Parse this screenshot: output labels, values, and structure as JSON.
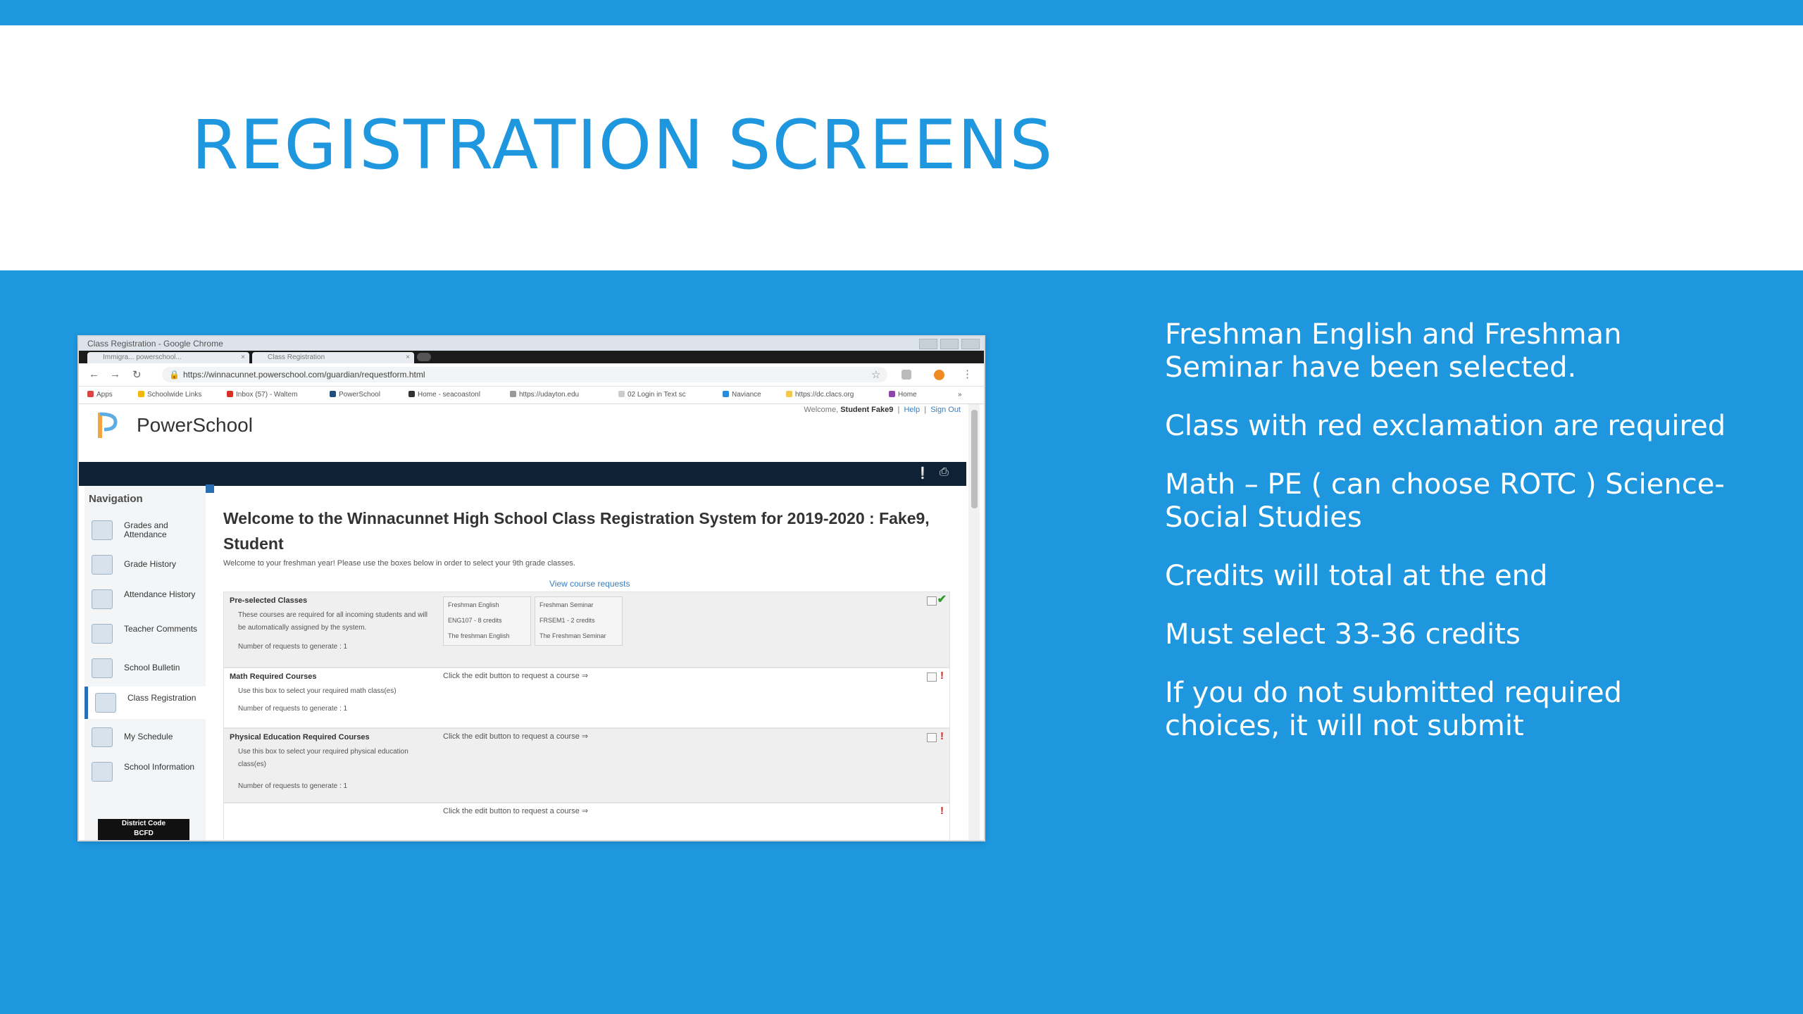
{
  "slide": {
    "title": "REGISTRATION SCREENS",
    "bullets": [
      "Freshman English and Freshman Seminar have been selected.",
      "Class with red exclamation are required",
      "Math – PE ( can choose ROTC ) Science-Social Studies",
      "Credits will total at the end",
      "Must select 33-36 credits",
      "If you do not submitted required choices, it will not submit"
    ]
  },
  "browser": {
    "window_title": "Class Registration - Google Chrome",
    "tabs": [
      "Immigra... powerschool...",
      "Class Registration"
    ],
    "url": "https://winnacunnet.powerschool.com/guardian/requestform.html",
    "bookmarks": [
      "Apps",
      "Schoolwide Links",
      "Inbox (57) - Waltem",
      "PowerSchool",
      "Home - seacoastonl",
      "https://udayton.edu",
      "02 Login in Text sc",
      "Naviance",
      "https://dc.clacs.org",
      "Home",
      "»"
    ]
  },
  "powerschool": {
    "brand": "PowerSchool",
    "welcome_prefix": "Welcome,",
    "user": "Student Fake9",
    "help": "Help",
    "signout": "Sign Out",
    "nav_heading": "Navigation",
    "nav_items": [
      "Grades and Attendance",
      "Grade History",
      "Attendance History",
      "Teacher Comments",
      "School Bulletin",
      "Class Registration",
      "My Schedule",
      "School Information"
    ],
    "district_code_label": "District Code",
    "district_code_value": "BCFD",
    "page_title": "Welcome to the Winnacunnet High School Class Registration System for 2019-2020 : Fake9, Student",
    "intro": "Welcome to your freshman year! Please use the boxes below in order to select your 9th grade classes.",
    "view_requests": "View course requests",
    "sections": [
      {
        "title": "Pre-selected Classes",
        "desc": "These courses are required for all incoming students and will be automatically assigned by the system.",
        "req": "Number of requests to generate : 1",
        "courses": [
          {
            "name": "Freshman English",
            "code": "ENG107 - 8 credits",
            "desc": "The freshman English"
          },
          {
            "name": "Freshman Seminar",
            "code": "FRSEM1 - 2 credits",
            "desc": "The Freshman Seminar"
          }
        ]
      },
      {
        "title": "Math Required Courses",
        "desc": "Use this box to select your required math class(es)",
        "req": "Number of requests to generate : 1",
        "edit": "Click the edit button to request a course ⇒"
      },
      {
        "title": "Physical Education Required Courses",
        "desc": "Use this box to select your required physical education class(es)",
        "req": "Number of requests to generate : 1",
        "edit": "Click the edit button to request a course ⇒"
      },
      {
        "edit": "Click the edit button to request a course ⇒"
      }
    ]
  },
  "colors": {
    "accent": "#1E97DE",
    "title": "#1E97DE",
    "ps_dark_bar": "#0F2235"
  }
}
